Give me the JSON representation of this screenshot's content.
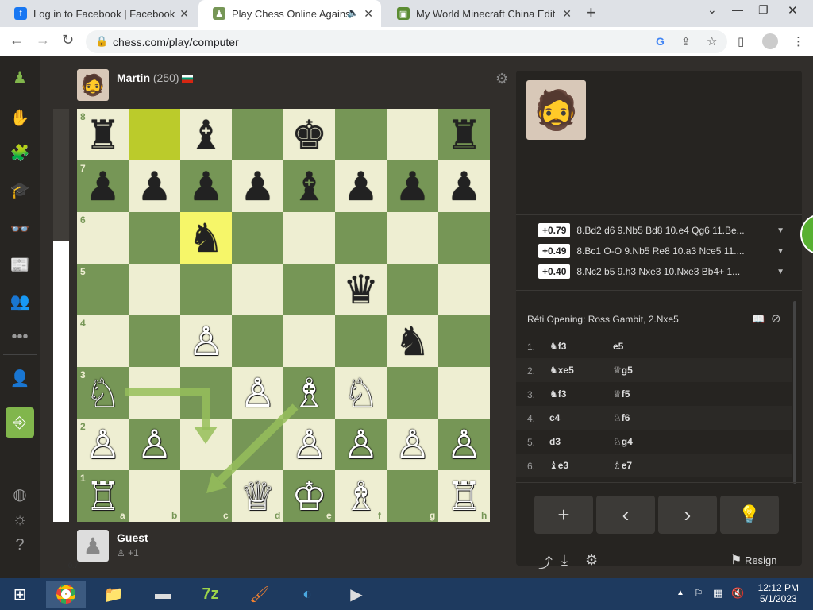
{
  "browser": {
    "tabs": [
      {
        "title": "Log in to Facebook | Facebook",
        "icon": "facebook-icon"
      },
      {
        "title": "Play Chess Online Against th",
        "icon": "chess-pawn-icon"
      },
      {
        "title": "My World Minecraft China Editic",
        "icon": "minecraft-icon"
      }
    ],
    "url": "chess.com/play/computer"
  },
  "top_player": {
    "name": "Martin",
    "rating": "(250)"
  },
  "bottom_player": {
    "name": "Guest",
    "material": "+1"
  },
  "eval": {
    "value": "0.7"
  },
  "board": {
    "files": [
      "a",
      "b",
      "c",
      "d",
      "e",
      "f",
      "g",
      "h"
    ],
    "ranks": [
      "8",
      "7",
      "6",
      "5",
      "4",
      "3",
      "2",
      "1"
    ],
    "light_color": "#eeeed2",
    "dark_color": "#769656",
    "highlight_color": "#f6f669"
  },
  "engine_lines": [
    {
      "score": "+0.79",
      "moves": "8.Bd2 d6 9.Nb5 Bd8 10.e4 Qg6 11.Be..."
    },
    {
      "score": "+0.49",
      "moves": "8.Bc1 O-O 9.Nb5 Re8 10.a3 Nce5 11...."
    },
    {
      "score": "+0.40",
      "moves": "8.Nc2 b5 9.h3 Nxe3 10.Nxe3 Bb4+ 1..."
    }
  ],
  "opening": "Réti Opening: Ross Gambit, 2.Nxe5",
  "moves": [
    {
      "num": "1.",
      "w": "f3",
      "wp": "♞",
      "b": "e5",
      "bp": ""
    },
    {
      "num": "2.",
      "w": "xe5",
      "wp": "♞",
      "b": "g5",
      "bp": "♕"
    },
    {
      "num": "3.",
      "w": "f3",
      "wp": "♞",
      "b": "f5",
      "bp": "♕"
    },
    {
      "num": "4.",
      "w": "c4",
      "wp": "",
      "b": "f6",
      "bp": "♘"
    },
    {
      "num": "5.",
      "w": "d3",
      "wp": "",
      "b": "g4",
      "bp": "♘"
    },
    {
      "num": "6.",
      "w": "e3",
      "wp": "♝",
      "b": "e7",
      "bp": "♗"
    }
  ],
  "controls": {
    "add": "+",
    "prev": "‹",
    "next": "›",
    "hint": "💡",
    "resign": "Resign"
  },
  "taskbar": {
    "time": "12:12 PM",
    "date": "5/1/2023"
  }
}
